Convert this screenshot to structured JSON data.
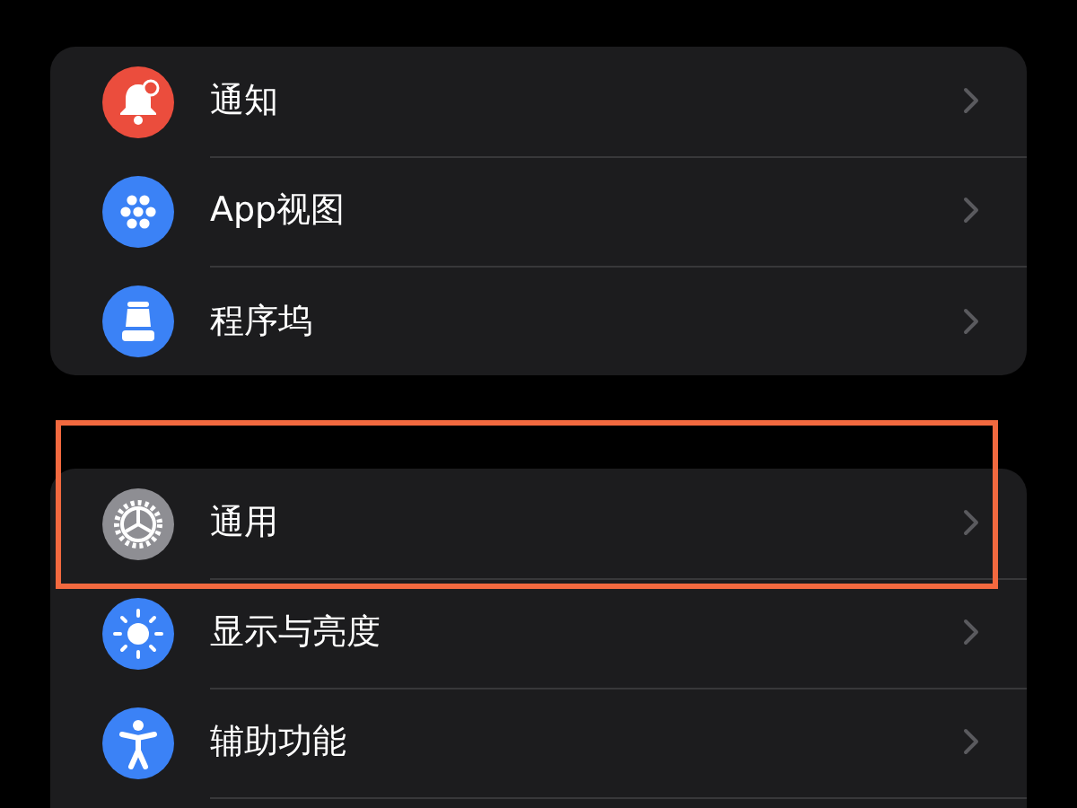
{
  "groups": [
    {
      "items": [
        {
          "label": "通知",
          "kind": "bell",
          "color": "#eb4d3d",
          "highlighted": false
        },
        {
          "label": "App视图",
          "kind": "dots",
          "color": "#3b82f6",
          "highlighted": false
        },
        {
          "label": "程序坞",
          "kind": "dock",
          "color": "#3b82f6",
          "highlighted": false
        }
      ]
    },
    {
      "items": [
        {
          "label": "通用",
          "kind": "gear",
          "color": "#8e8e93",
          "highlighted": true
        },
        {
          "label": "显示与亮度",
          "kind": "sun",
          "color": "#3b82f6",
          "highlighted": false
        },
        {
          "label": "辅助功能",
          "kind": "person",
          "color": "#3b82f6",
          "highlighted": false
        }
      ]
    }
  ]
}
